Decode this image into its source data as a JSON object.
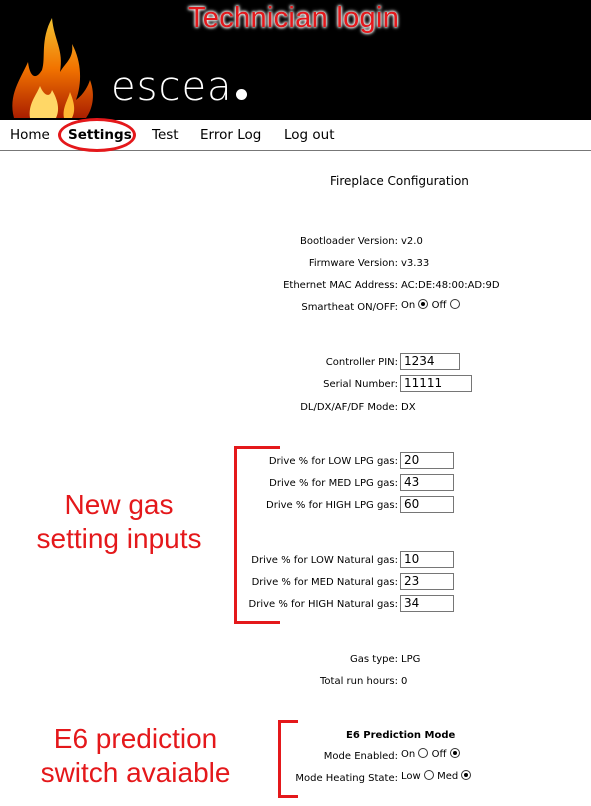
{
  "annotations": {
    "title": "Technician login",
    "new_gas_line1": "New gas",
    "new_gas_line2": "setting inputs",
    "e6_line1": "E6 prediction",
    "e6_line2": "switch avaiable"
  },
  "header": {
    "logo_text": "escea"
  },
  "nav": {
    "items": [
      {
        "label": "Home"
      },
      {
        "label": "Settings"
      },
      {
        "label": "Test"
      },
      {
        "label": "Error Log"
      },
      {
        "label": "Log out"
      }
    ],
    "active": "Settings"
  },
  "page": {
    "heading": "Fireplace Configuration"
  },
  "info": {
    "bootloader_label": "Bootloader Version:",
    "bootloader_value": "v2.0",
    "firmware_label": "Firmware Version:",
    "firmware_value": "v3.33",
    "mac_label": "Ethernet MAC Address:",
    "mac_value": "AC:DE:48:00:AD:9D",
    "smartheat_label": "Smartheat ON/OFF:",
    "smartheat_on": "On",
    "smartheat_off": "Off",
    "smartheat_selected": "On"
  },
  "controller": {
    "pin_label": "Controller PIN:",
    "pin_value": "1234",
    "serial_label": "Serial Number:",
    "serial_value": "11111",
    "mode_label": "DL/DX/AF/DF Mode:",
    "mode_value": "DX"
  },
  "lpg": {
    "low_label": "Drive % for LOW LPG gas:",
    "low_value": "20",
    "med_label": "Drive % for MED LPG gas:",
    "med_value": "43",
    "high_label": "Drive % for HIGH LPG gas:",
    "high_value": "60"
  },
  "natural": {
    "low_label": "Drive % for LOW Natural gas:",
    "low_value": "10",
    "med_label": "Drive % for MED Natural gas:",
    "med_value": "23",
    "high_label": "Drive % for HIGH Natural gas:",
    "high_value": "34"
  },
  "status": {
    "gas_type_label": "Gas type:",
    "gas_type_value": "LPG",
    "run_hours_label": "Total run hours:",
    "run_hours_value": "0"
  },
  "e6": {
    "heading": "E6 Prediction Mode",
    "enabled_label": "Mode Enabled:",
    "enabled_on": "On",
    "enabled_off": "Off",
    "enabled_selected": "Off",
    "heating_label": "Mode Heating State:",
    "heating_low": "Low",
    "heating_med": "Med",
    "heating_selected": "Med"
  },
  "colors": {
    "annotation_red": "#e4181b",
    "header_bg": "#000000"
  }
}
